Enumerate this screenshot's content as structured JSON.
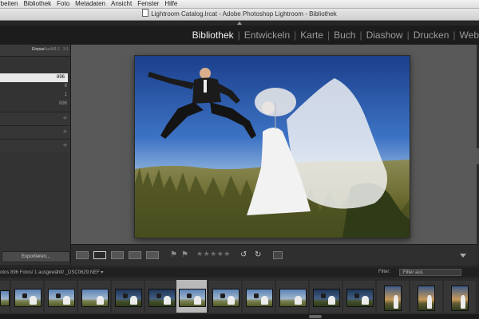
{
  "menubar": {
    "items": [
      "rbeiten",
      "Bibliothek",
      "Foto",
      "Metadaten",
      "Ansicht",
      "Fenster",
      "Hilfe"
    ]
  },
  "window": {
    "title": "Lightroom Catalog.lrcat - Adobe Photoshop Lightroom - Bibliothek"
  },
  "modules": {
    "items": [
      "Bibliothek",
      "Entwickeln",
      "Karte",
      "Buch",
      "Diashow",
      "Drucken",
      "Web"
    ],
    "separator": "|",
    "active": "Bibliothek"
  },
  "left_panel": {
    "navigator_tabs": [
      "Einpas",
      "Ausfül",
      "1:1",
      "3:1"
    ],
    "catalog_counts": [
      "896",
      "8",
      "1",
      "896"
    ],
    "export_label": "Exportieren..."
  },
  "toolbar": {
    "stars": "★★★★★",
    "flag": "⚑",
    "rotate_left": "↺",
    "rotate_right": "↻"
  },
  "filmstrip_bar": {
    "source_text": "otos  896 Fotos/ 1 ausgewählt/ _DSC0629.NEF ▾",
    "filter_label": "Filter:",
    "filter_value": "Filter aus"
  },
  "colors": {
    "accent_active": "#f2f2f2",
    "panel_bg": "#333333",
    "loupe_bg": "#595959",
    "selected_cell": "#b9b9b9"
  }
}
